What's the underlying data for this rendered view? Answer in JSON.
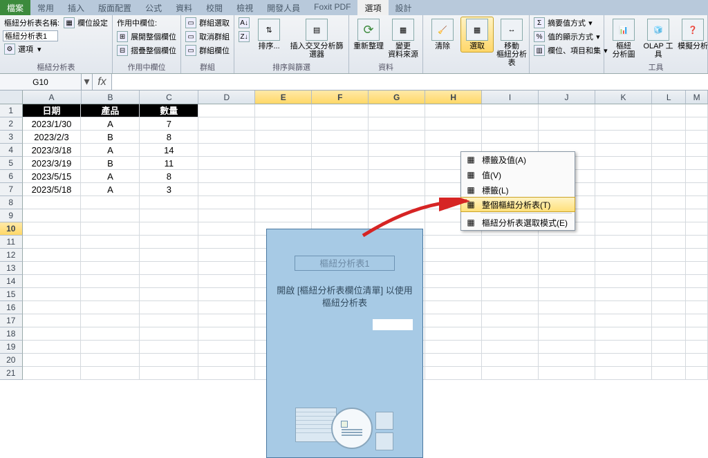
{
  "tabs": [
    "檔案",
    "常用",
    "插入",
    "版面配置",
    "公式",
    "資料",
    "校閱",
    "檢視",
    "開發人員",
    "Foxit PDF",
    "選項",
    "設計"
  ],
  "active_tab_index": 10,
  "ribbon": {
    "g1": {
      "label": "樞紐分析表",
      "lbl_name": "樞紐分析表名稱:",
      "name_val": "樞紐分析表1",
      "options": "選項",
      "col_set": "欄位設定"
    },
    "g2": {
      "label": "作用中欄位",
      "active": "作用中欄位:",
      "expand": "展開整個欄位",
      "collapse": "摺疊整個欄位"
    },
    "g3": {
      "label": "群組",
      "gsel": "群組選取",
      "gungroup": "取消群組",
      "gfield": "群組欄位"
    },
    "g4": {
      "label": "排序與篩選",
      "sort": "排序...",
      "slicer": "插入交叉分析篩選器"
    },
    "g5": {
      "label": "資料",
      "refresh": "重新整理",
      "change": "變更\n資料來源"
    },
    "g6": {
      "clear": "清除",
      "select": "選取",
      "move": "移動\n樞紐分析表"
    },
    "g7": {
      "summary": "摘要值方式",
      "show": "值的顯示方式",
      "fields": "欄位、項目和集"
    },
    "g8": {
      "label": "工具",
      "chart": "樞紐\n分析圖",
      "olap": "OLAP 工具",
      "whatif": "模擬分析"
    }
  },
  "name_box": "G10",
  "columns": [
    "A",
    "B",
    "C",
    "D",
    "E",
    "F",
    "G",
    "H",
    "I",
    "J",
    "K",
    "L",
    "M"
  ],
  "sel_cols": [
    4,
    5,
    6,
    7
  ],
  "row_count": 21,
  "sel_rows": [
    10
  ],
  "table": {
    "headers": [
      "日期",
      "產品",
      "數量"
    ],
    "rows": [
      [
        "2023/1/30",
        "A",
        "7"
      ],
      [
        "2023/2/3",
        "B",
        "8"
      ],
      [
        "2023/3/18",
        "A",
        "14"
      ],
      [
        "2023/3/19",
        "B",
        "11"
      ],
      [
        "2023/5/15",
        "A",
        "8"
      ],
      [
        "2023/5/18",
        "A",
        "3"
      ]
    ]
  },
  "pivot": {
    "title": "樞紐分析表1",
    "msg": "開啟 [樞紐分析表欄位清單] 以使用樞紐分析表"
  },
  "menu": {
    "items": [
      {
        "label": "標籤及值(A)",
        "hl": false
      },
      {
        "label": "值(V)",
        "hl": false
      },
      {
        "label": "標籤(L)",
        "hl": false
      },
      {
        "label": "整個樞紐分析表(T)",
        "hl": true
      },
      {
        "label": "樞紐分析表選取模式(E)",
        "hl": false,
        "sep": true
      }
    ]
  }
}
